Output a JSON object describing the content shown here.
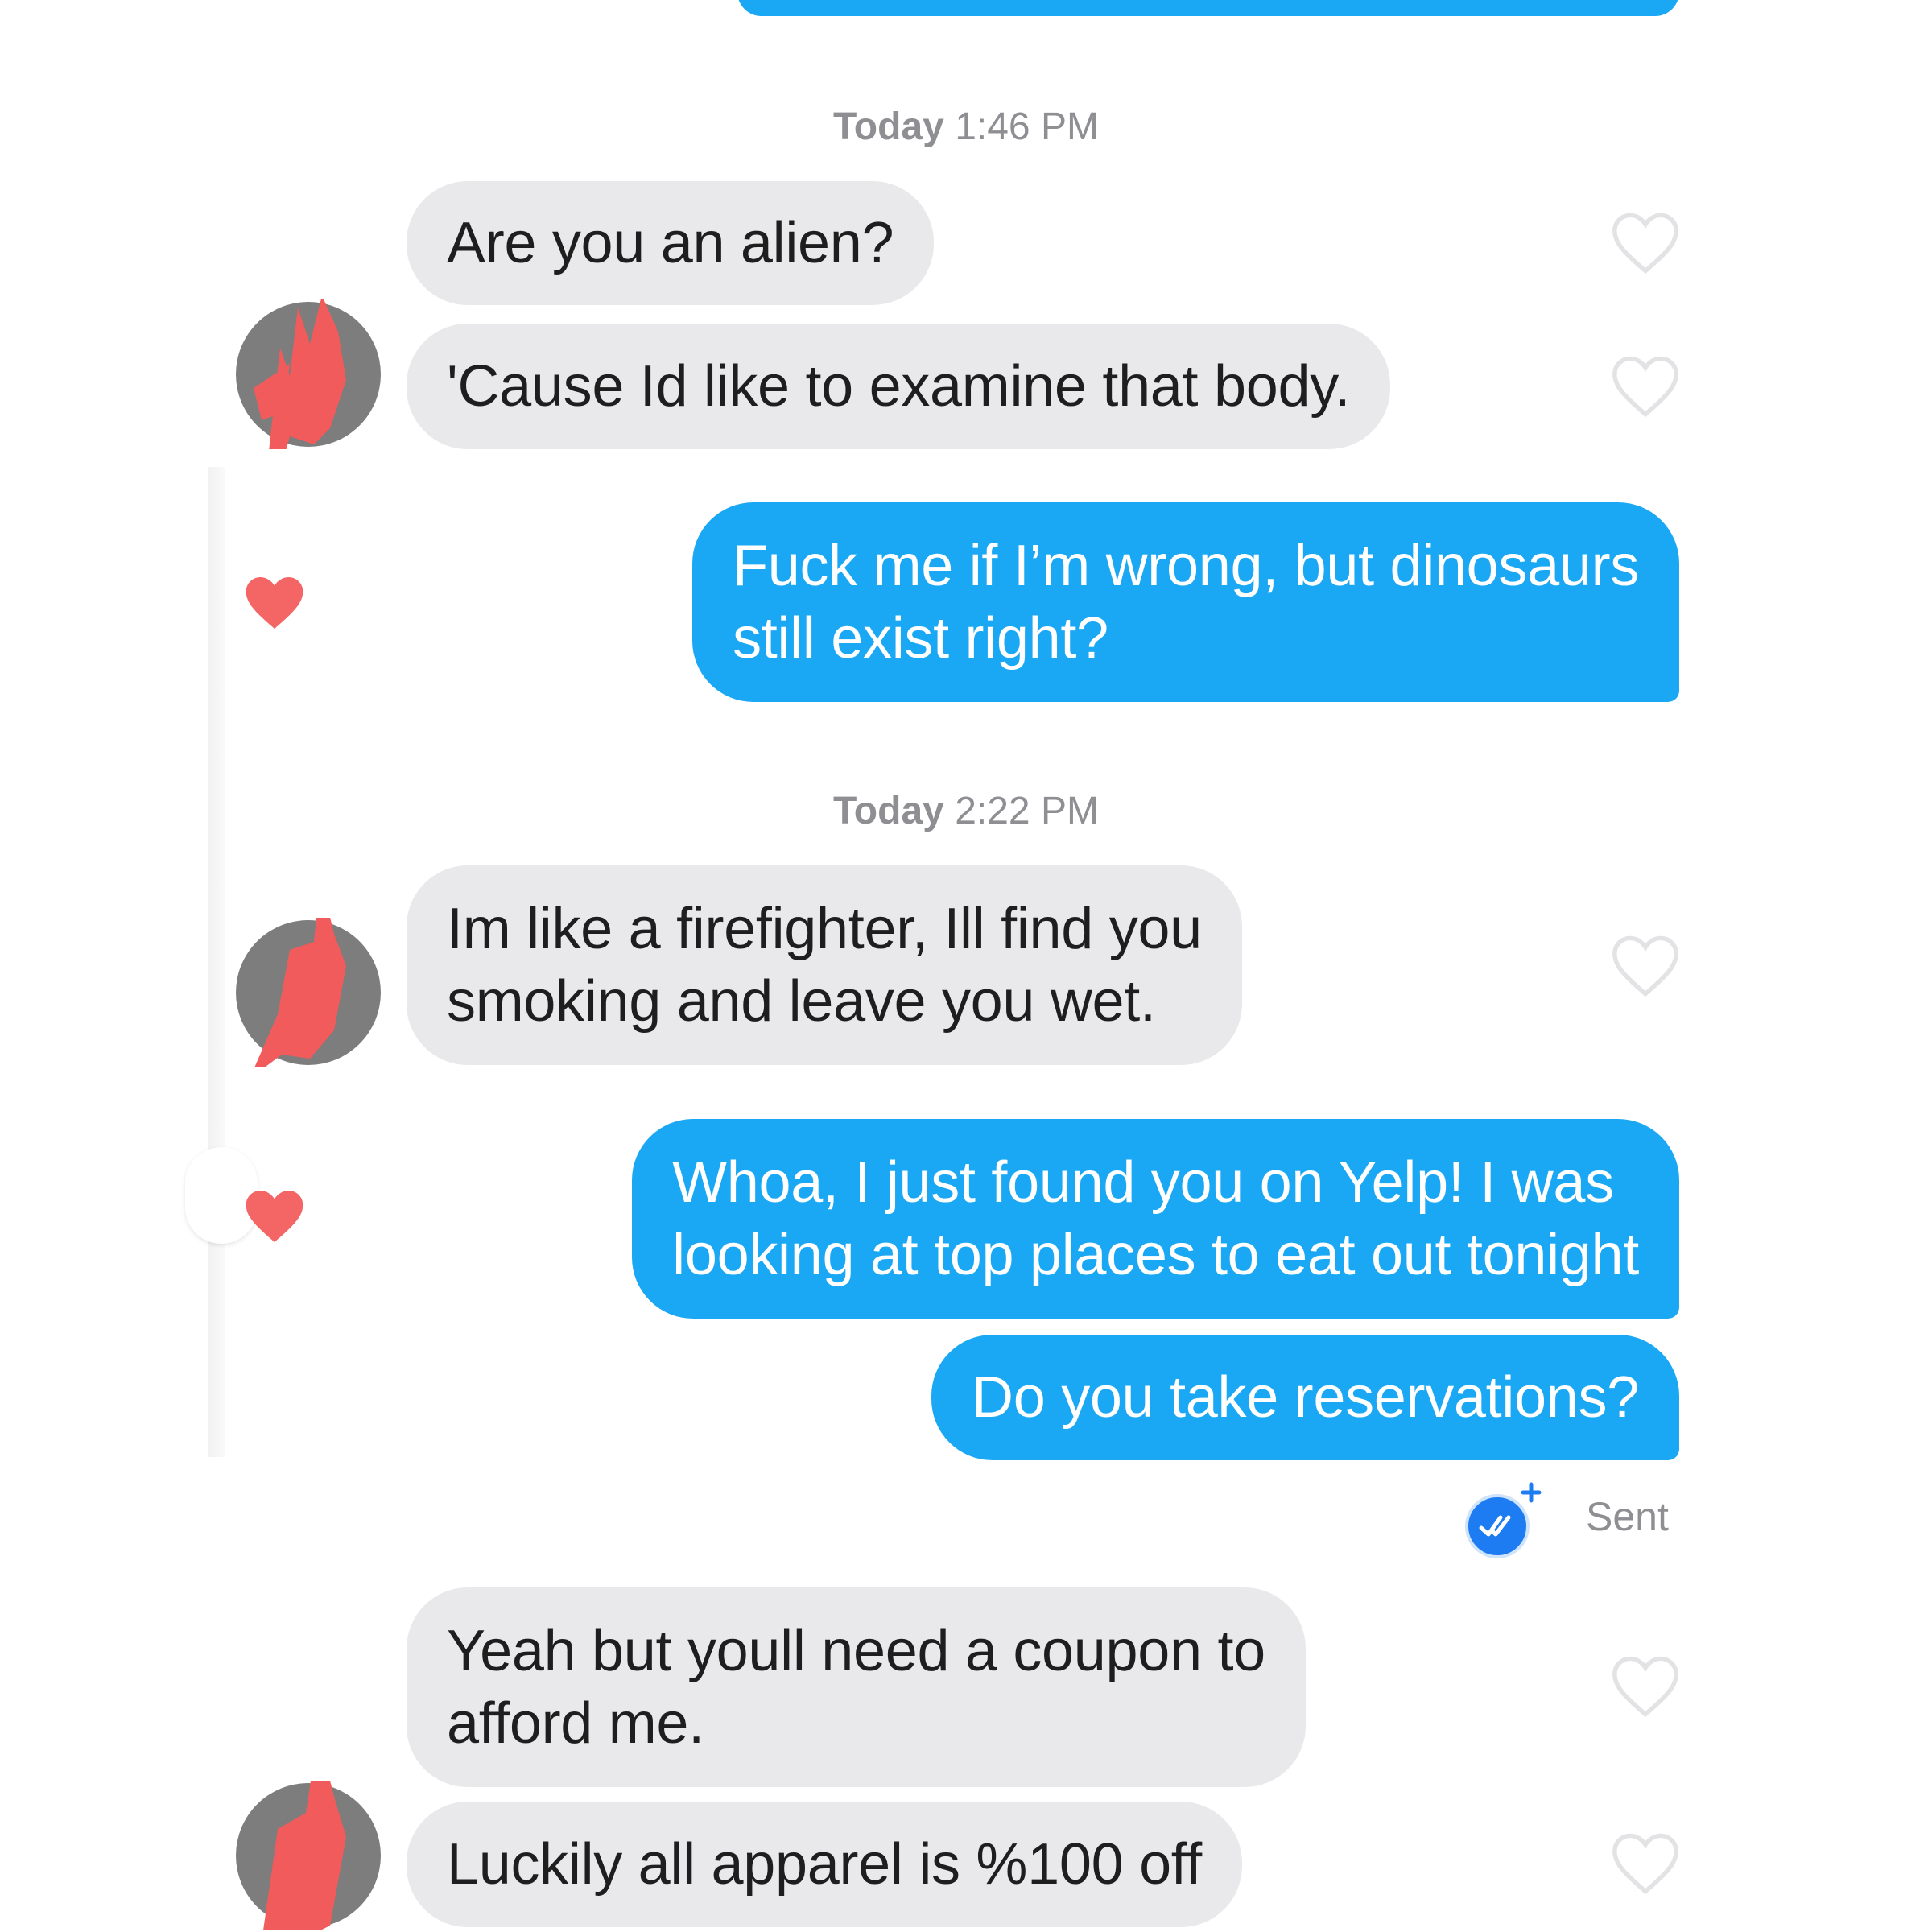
{
  "colors": {
    "outgoing_bubble": "#1aa8f4",
    "incoming_bubble": "#e9e9eb",
    "timestamp_text": "#8e8e93",
    "like_heart": "#f46565",
    "receipt_badge": "#1d7cf2",
    "redaction": "#f15b5b"
  },
  "timestamps": [
    {
      "day": "Today",
      "time": "1:46 PM"
    },
    {
      "day": "Today",
      "time": "2:22 PM"
    }
  ],
  "messages": [
    {
      "text": "Are you an alien?",
      "direction": "incoming",
      "liked": false
    },
    {
      "text": "'Cause Id like to examine that body.",
      "direction": "incoming",
      "liked": false
    },
    {
      "text": "Fuck me if I’m wrong, but dinosaurs\nstill exist right?",
      "direction": "outgoing",
      "liked": true
    },
    {
      "text": "Im like a firefighter, Ill find you\nsmoking and leave you wet.",
      "direction": "incoming",
      "liked": false
    },
    {
      "text": "Whoa, I just found you on Yelp! I was\nlooking at top places to eat out tonight",
      "direction": "outgoing",
      "liked": true
    },
    {
      "text": "Do you take reservations?",
      "direction": "outgoing",
      "liked": false
    },
    {
      "text": "Yeah but youll need a coupon to\nafford me.",
      "direction": "incoming",
      "liked": false
    },
    {
      "text": "Luckily all apparel is %100 off",
      "direction": "incoming",
      "liked": false
    }
  ],
  "status": {
    "label": "Sent",
    "icon": "read-receipt-icon"
  },
  "icons": {
    "like_empty": "heart-outline-icon",
    "like_filled": "heart-filled-icon",
    "avatar": "redacted-avatar"
  }
}
